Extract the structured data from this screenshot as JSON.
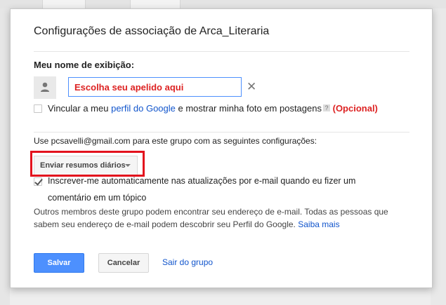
{
  "dialog": {
    "title": "Configurações de associação de Arca_Literaria",
    "display_name_label": "Meu nome de exibição:",
    "name_input": {
      "value": "",
      "placeholder": "Escolha seu apelido aqui"
    },
    "profile_link": {
      "prefix": "Vincular a meu ",
      "link": "perfil do Google",
      "suffix": " e mostrar minha foto em postagens",
      "help": "?",
      "optional": "(Opcional)",
      "checked": false
    },
    "email_line": "Use pcsavelli@gmail.com para este grupo com as seguintes configurações:",
    "digest_select": {
      "label": "Enviar resumos diários"
    },
    "auto_subscribe": {
      "line1": "Inscrever-me automaticamente nas atualizações por e-mail quando eu fizer um",
      "line2": "comentário em um tópico",
      "checked": true
    },
    "info": {
      "text": "Outros membros deste grupo podem encontrar seu endereço de e-mail. Todas as pessoas que sabem seu endereço de e-mail podem descobrir seu Perfil do Google.",
      "link": "Saiba mais"
    },
    "buttons": {
      "save": "Salvar",
      "cancel": "Cancelar",
      "leave": "Sair do grupo"
    }
  },
  "colors": {
    "accent": "#4d90fe",
    "highlight": "#e3121d",
    "link": "#1155cc",
    "warning": "#dd2222"
  }
}
